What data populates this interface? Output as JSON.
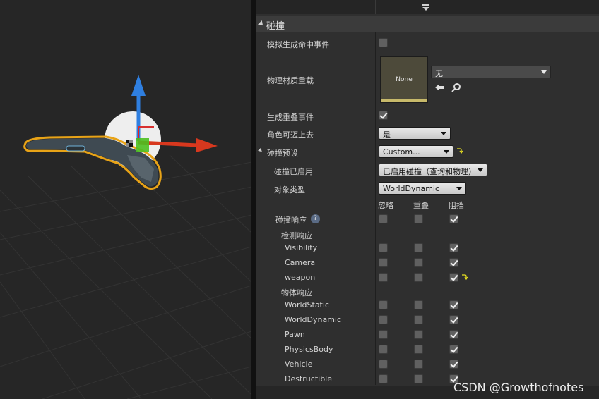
{
  "details": {
    "section_title": "碰撞",
    "sim_hit_label": "模拟生成命中事件",
    "phys_mat_label": "物理材质重载",
    "phys_mat_thumb": "None",
    "phys_mat_value": "无",
    "overlap_label": "生成重叠事件",
    "step_up_label": "角色可迈上去",
    "step_up_value": "是",
    "preset_label": "碰撞预设",
    "preset_value": "Custom...",
    "enabled_label": "碰撞已启用",
    "enabled_value": "已启用碰撞（查询和物理）",
    "object_type_label": "对象类型",
    "object_type_value": "WorldDynamic",
    "col_ignore": "忽略",
    "col_overlap": "重叠",
    "col_block": "阻挡",
    "responses_label": "碰撞响应",
    "trace_label": "检测响应",
    "trace_items": [
      "Visibility",
      "Camera",
      "weapon"
    ],
    "object_label": "物体响应",
    "object_items": [
      "WorldStatic",
      "WorldDynamic",
      "Pawn",
      "PhysicsBody",
      "Vehicle",
      "Destructible"
    ]
  },
  "watermark": "CSDN @Growthofnotes",
  "colors": {
    "viewport_bg": "#262626",
    "panel_bg": "#2f2f2f",
    "gizmo_blue": "#2f7fe0",
    "gizmo_red": "#d8381e",
    "gizmo_green": "#4cc020",
    "selection_orange": "#e8a317",
    "thumb_accent": "#c7b96a"
  },
  "icons": [
    "toggle-chevron-icon",
    "reset-arrow-icon",
    "browse-arrow-icon",
    "search-icon",
    "help-icon"
  ]
}
